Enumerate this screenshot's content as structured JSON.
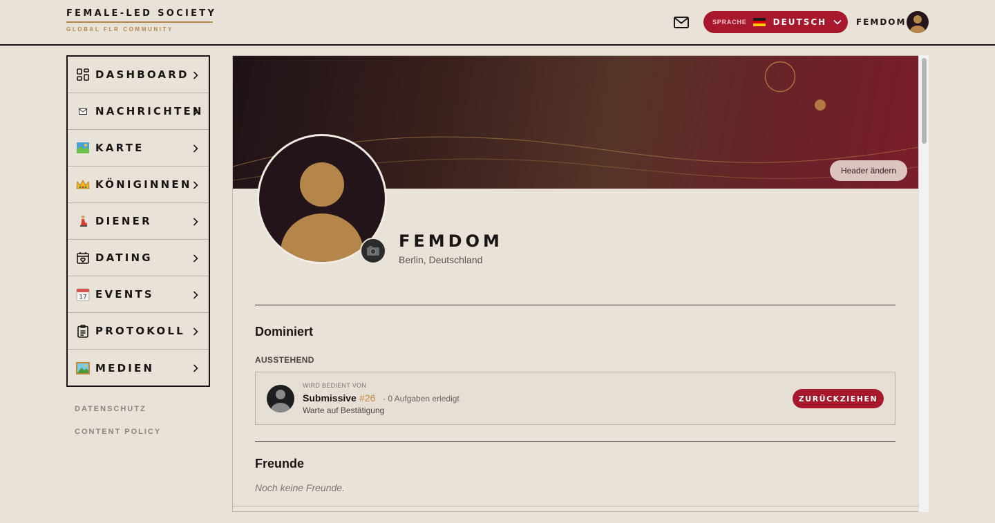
{
  "brand": {
    "title": "FEMALE-LED SOCIETY",
    "subtitle": "GLOBAL FLR COMMUNITY"
  },
  "header": {
    "language_label": "SPRACHE",
    "language_value": "DEUTSCH",
    "user_name": "FEMDOM"
  },
  "sidebar": {
    "items": [
      {
        "label": "DASHBOARD",
        "icon": "grid-icon"
      },
      {
        "label": "NACHRICHTEN",
        "icon": "envelope-icon"
      },
      {
        "label": "KARTE",
        "icon": "map-icon"
      },
      {
        "label": "KÖNIGINNEN",
        "icon": "crown-icon"
      },
      {
        "label": "DIENER",
        "icon": "kneeling-person-icon"
      },
      {
        "label": "DATING",
        "icon": "calendar-heart-icon"
      },
      {
        "label": "EVENTS",
        "icon": "calendar-icon"
      },
      {
        "label": "PROTOKOLL",
        "icon": "clipboard-icon"
      },
      {
        "label": "MEDIEN",
        "icon": "picture-icon"
      }
    ],
    "footer_links": [
      "DATENSCHUTZ",
      "CONTENT POLICY"
    ]
  },
  "profile": {
    "change_header_label": "Header ändern",
    "name": "FEMDOM",
    "location": "Berlin, Deutschland"
  },
  "dominated": {
    "title": "Dominiert",
    "pending_label": "AUSSTEHEND",
    "card": {
      "overline": "WIRD BEDIENT VON",
      "name": "Submissive",
      "number": "#26",
      "tasks": "· 0 Aufgaben erledigt",
      "status": "Warte auf Bestätigung",
      "withdraw_label": "ZURÜCKZIEHEN"
    }
  },
  "friends": {
    "title": "Freunde",
    "empty_text": "Noch keine Freunde."
  },
  "colors": {
    "accent": "#a8182d",
    "gold": "#b5864a",
    "background": "#e9e2d8",
    "ink": "#1a1414"
  }
}
